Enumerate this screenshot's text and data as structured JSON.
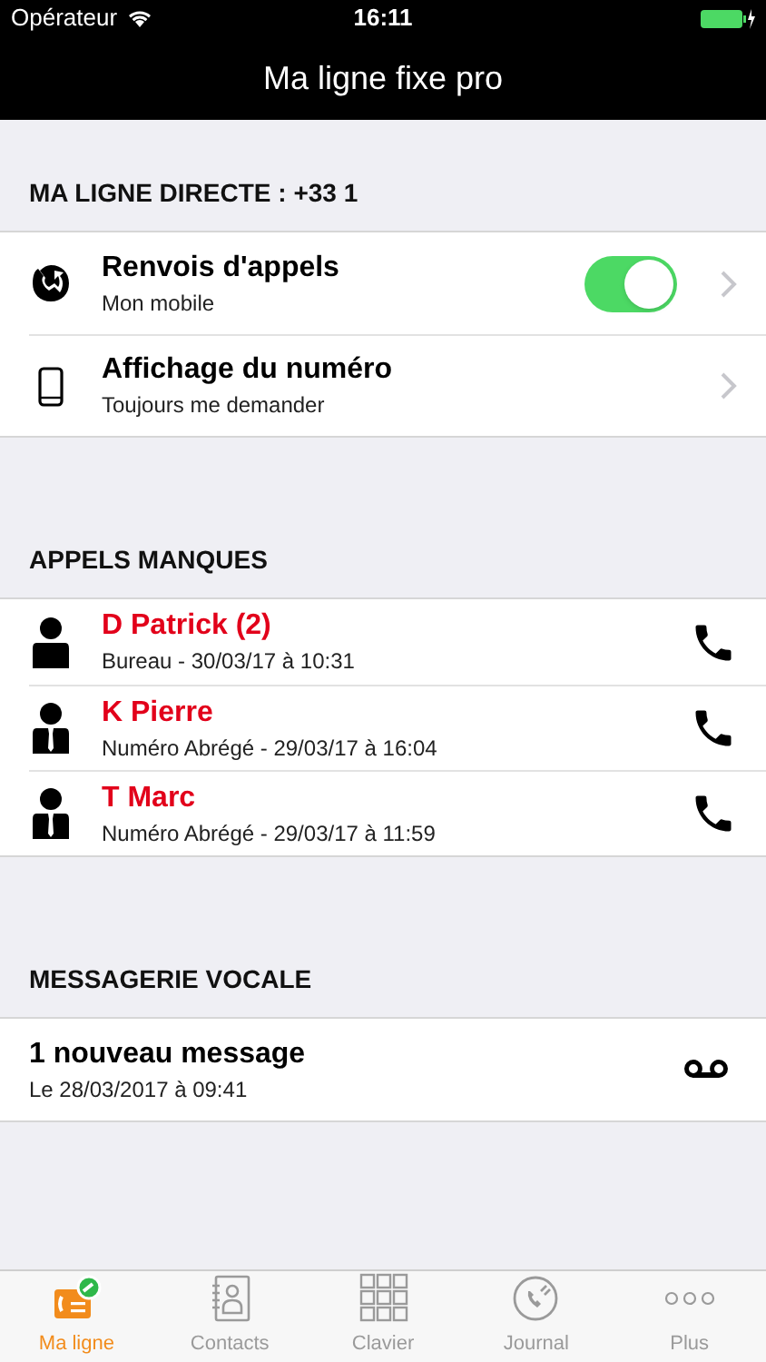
{
  "status_bar": {
    "carrier": "Opérateur",
    "time": "16:11"
  },
  "nav": {
    "title": "Ma ligne fixe pro"
  },
  "sections": [
    {
      "header": "MA LIGNE DIRECTE : +33 1",
      "kind": "settings",
      "items": [
        {
          "kind": "forward",
          "title": "Renvois d'appels",
          "subtitle": "Mon mobile",
          "toggle": {
            "on": true
          }
        },
        {
          "kind": "phone",
          "title": "Affichage du numéro",
          "subtitle": "Toujours me demander"
        }
      ]
    },
    {
      "header": "APPELS MANQUES",
      "kind": "calls",
      "items": [
        {
          "kind": "person",
          "title": "D Patrick (2)",
          "subtitle": "Bureau - 30/03/17 à 10:31"
        },
        {
          "kind": "person-tie",
          "title": "K Pierre",
          "subtitle": "Numéro Abrégé - 29/03/17 à 16:04"
        },
        {
          "kind": "person-tie",
          "title": "T Marc",
          "subtitle": "Numéro Abrégé - 29/03/17 à 11:59"
        }
      ]
    },
    {
      "header": "MESSAGERIE VOCALE",
      "kind": "voicemail",
      "items": [
        {
          "kind": "voicemail",
          "title": "1 nouveau message",
          "subtitle": "Le 28/03/2017 à 09:41"
        }
      ]
    }
  ],
  "tab_bar": [
    {
      "kind": "line",
      "label": "Ma ligne",
      "selected": true
    },
    {
      "kind": "contacts",
      "label": "Contacts",
      "selected": false
    },
    {
      "kind": "keypad",
      "label": "Clavier",
      "selected": false
    },
    {
      "kind": "journal",
      "label": "Journal",
      "selected": false
    },
    {
      "kind": "more",
      "label": "Plus",
      "selected": false
    }
  ]
}
